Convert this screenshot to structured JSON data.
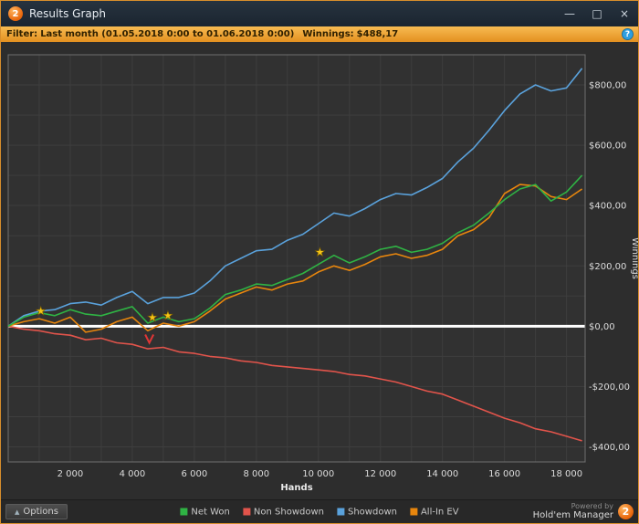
{
  "window": {
    "title": "Results Graph",
    "logo_text": "2",
    "minimize_label": "—",
    "maximize_label": "□",
    "close_label": "×"
  },
  "filter_bar": {
    "filter_label": "Filter:",
    "filter_value": "Last month (01.05.2018 0:00 to 01.06.2018 0:00)",
    "winnings_label": "Winnings:",
    "winnings_value": "$488,17",
    "help_icon_text": "?"
  },
  "status_bar": {
    "options_label": "Options",
    "options_icon": "▲",
    "powered_by": "Powered by",
    "brand": "Hold'em Manager",
    "brand_logo_text": "2"
  },
  "colors": {
    "net_won": "#2fb344",
    "non_showdown": "#e2544b",
    "showdown": "#5aa2dc",
    "all_in_ev": "#e8860d",
    "zero_line": "#ffffff",
    "star": "#f5c518",
    "arrow": "#e03535",
    "accent_orange": "#f0a232"
  },
  "chart_data": {
    "type": "line",
    "title": "",
    "xlabel": "Hands",
    "ylabel": "Winnings",
    "xlim": [
      0,
      18600
    ],
    "ylim": [
      -450,
      900
    ],
    "x_grid_step": 1000,
    "y_grid_step": 100,
    "legend_position": "bottom",
    "x_ticks": [
      {
        "v": 2000,
        "label": "2 000"
      },
      {
        "v": 4000,
        "label": "4 000"
      },
      {
        "v": 6000,
        "label": "6 000"
      },
      {
        "v": 8000,
        "label": "8 000"
      },
      {
        "v": 10000,
        "label": "10 000"
      },
      {
        "v": 12000,
        "label": "12 000"
      },
      {
        "v": 14000,
        "label": "14 000"
      },
      {
        "v": 16000,
        "label": "16 000"
      },
      {
        "v": 18000,
        "label": "18 000"
      }
    ],
    "y_ticks": [
      {
        "v": 800,
        "label": "$800,00"
      },
      {
        "v": 600,
        "label": "$600,00"
      },
      {
        "v": 400,
        "label": "$400,00"
      },
      {
        "v": 200,
        "label": "$200,00"
      },
      {
        "v": 0,
        "label": "$0,00"
      },
      {
        "v": -200,
        "label": "-$200,00"
      },
      {
        "v": -400,
        "label": "-$400,00"
      }
    ],
    "x": [
      0,
      500,
      1000,
      1500,
      2000,
      2500,
      3000,
      3500,
      4000,
      4500,
      5000,
      5500,
      6000,
      6500,
      7000,
      7500,
      8000,
      8500,
      9000,
      9500,
      10000,
      10500,
      11000,
      11500,
      12000,
      12500,
      13000,
      13500,
      14000,
      14500,
      15000,
      15500,
      16000,
      16500,
      17000,
      17500,
      18000,
      18500
    ],
    "series": [
      {
        "name": "Net Won",
        "color": "#2fb344",
        "values": [
          0,
          30,
          45,
          35,
          55,
          40,
          35,
          50,
          65,
          10,
          30,
          15,
          25,
          60,
          105,
          120,
          140,
          135,
          155,
          175,
          205,
          235,
          210,
          230,
          255,
          265,
          245,
          255,
          275,
          310,
          335,
          375,
          420,
          455,
          470,
          415,
          445,
          500
        ]
      },
      {
        "name": "Non Showdown",
        "color": "#e2544b",
        "values": [
          0,
          -10,
          -15,
          -25,
          -30,
          -45,
          -40,
          -55,
          -60,
          -75,
          -70,
          -85,
          -90,
          -100,
          -105,
          -115,
          -120,
          -130,
          -135,
          -140,
          -145,
          -150,
          -160,
          -165,
          -175,
          -185,
          -200,
          -215,
          -225,
          -245,
          -265,
          -285,
          -305,
          -320,
          -340,
          -350,
          -365,
          -380
        ]
      },
      {
        "name": "Showdown",
        "color": "#5aa2dc",
        "values": [
          0,
          35,
          50,
          55,
          75,
          80,
          70,
          95,
          115,
          75,
          95,
          95,
          110,
          150,
          200,
          225,
          250,
          255,
          285,
          305,
          340,
          375,
          365,
          390,
          420,
          440,
          435,
          460,
          490,
          545,
          590,
          650,
          715,
          770,
          800,
          780,
          790,
          855
        ]
      },
      {
        "name": "All-In EV",
        "color": "#e8860d",
        "values": [
          0,
          15,
          25,
          10,
          30,
          -20,
          -10,
          15,
          30,
          -15,
          10,
          0,
          15,
          50,
          90,
          110,
          130,
          120,
          140,
          150,
          180,
          200,
          185,
          205,
          230,
          240,
          225,
          235,
          255,
          300,
          320,
          360,
          440,
          470,
          465,
          430,
          420,
          455
        ]
      }
    ],
    "markers": {
      "stars": [
        {
          "x": 1050,
          "y": 50
        },
        {
          "x": 4650,
          "y": 28
        },
        {
          "x": 5150,
          "y": 35
        },
        {
          "x": 10050,
          "y": 245
        }
      ],
      "arrows": [
        {
          "x": 4550,
          "y": -55
        }
      ]
    }
  }
}
